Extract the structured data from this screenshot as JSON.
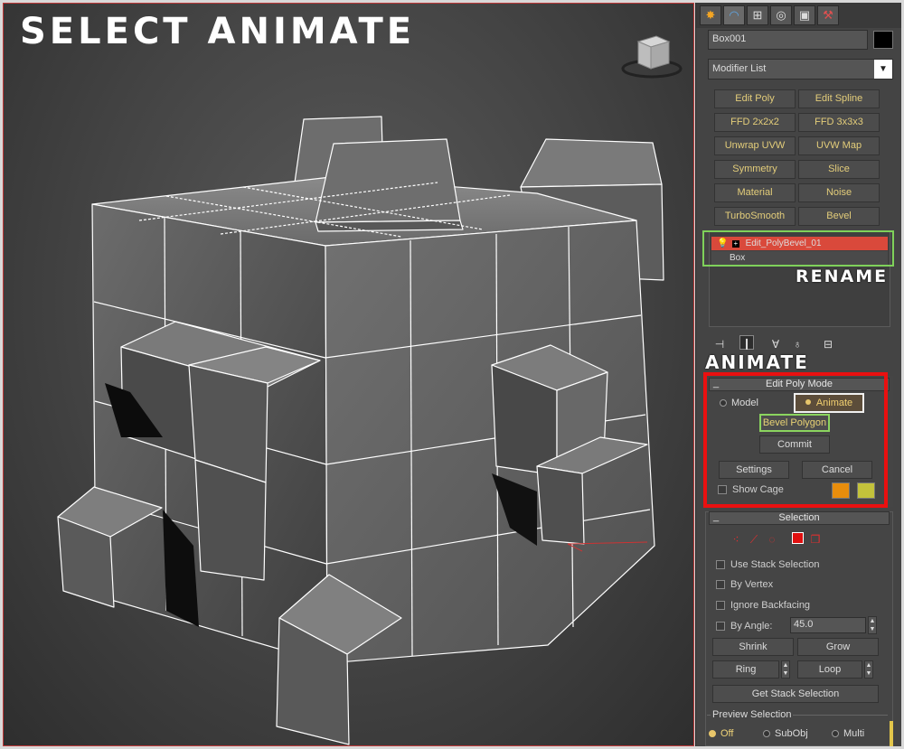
{
  "viewport": {
    "overlay_title": "SELECT ANIMATE",
    "viewcube_label": "ViewCube"
  },
  "command_panel": {
    "tabs": [
      "create-tab",
      "modify-tab",
      "hierarchy-tab",
      "motion-tab",
      "display-tab",
      "utilities-tab"
    ],
    "object_name": "Box001",
    "object_color": "#000000",
    "modifier_list_label": "Modifier List",
    "modifier_buttons": [
      "Edit Poly",
      "Edit Spline",
      "FFD 2x2x2",
      "FFD 3x3x3",
      "Unwrap UVW",
      "UVW Map",
      "Symmetry",
      "Slice",
      "Material",
      "Noise",
      "TurboSmooth",
      "Bevel"
    ],
    "stack": {
      "items": [
        "Edit_PolyBevel_01",
        "Box"
      ],
      "selected_index": 0
    },
    "overlay_rename": "RENAME",
    "overlay_animate": "ANIMATE",
    "edit_poly_mode": {
      "title": "Edit Poly Mode",
      "model_label": "Model",
      "animate_label": "Animate",
      "selected_mode": "Animate",
      "operation_label": "Bevel Polygon",
      "commit_label": "Commit",
      "settings_label": "Settings",
      "cancel_label": "Cancel",
      "show_cage_label": "Show Cage",
      "cage_color_1": "#e88d0c",
      "cage_color_2": "#c3c23b"
    },
    "selection": {
      "title": "Selection",
      "use_stack_label": "Use Stack Selection",
      "by_vertex_label": "By Vertex",
      "ignore_backfacing_label": "Ignore Backfacing",
      "by_angle_label": "By Angle:",
      "by_angle_value": "45.0",
      "shrink_label": "Shrink",
      "grow_label": "Grow",
      "ring_label": "Ring",
      "loop_label": "Loop",
      "get_stack_label": "Get Stack Selection",
      "preview_title": "Preview Selection",
      "preview_off": "Off",
      "preview_subobj": "SubObj",
      "preview_multi": "Multi",
      "preview_selected": "Off"
    }
  },
  "colors": {
    "highlight_red": "#ea1010",
    "highlight_green": "#7fd15a",
    "stack_selected": "#d9493b",
    "modifier_text": "#e3cd7a"
  }
}
